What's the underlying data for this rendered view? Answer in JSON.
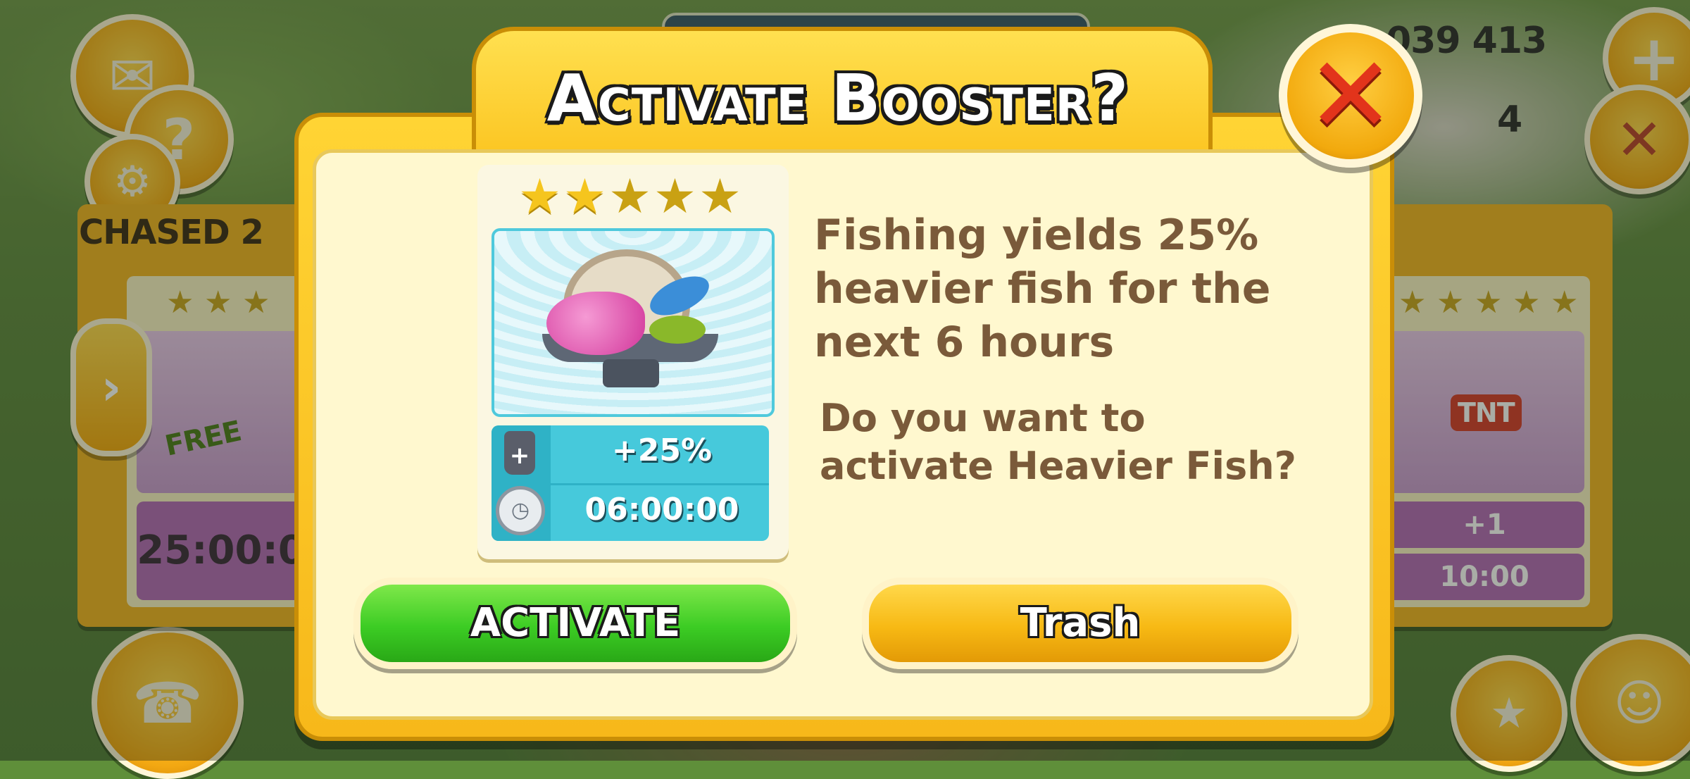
{
  "background": {
    "purchased_label": "CHASED 2",
    "top_number": "039 413",
    "top_count": "4",
    "left_card": {
      "stars": 3,
      "badge": "FREE",
      "timer": "25:00:0"
    },
    "right_card": {
      "stars": 5,
      "item_label": "TNT",
      "bonus": "+1",
      "timer": "10:00"
    }
  },
  "dialog": {
    "title": "Activate Booster?",
    "close_icon": "close-x-icon",
    "booster": {
      "stars_filled": 2,
      "stars_total": 5,
      "image_icon": "fish-bowl-icon",
      "bonus": "+25%",
      "duration": "06:00:00"
    },
    "description": "Fishing yields 25% heavier fish for the next 6 hours",
    "question": "Do you want to activate Heavier Fish?",
    "activate_label": "ACTIVATE",
    "trash_label": "Trash"
  },
  "colors": {
    "dialog_frame": "#f7b81a",
    "dialog_inner": "#fff8cf",
    "text_brown": "#7a5a3a",
    "activate_green": "#3ccc24",
    "trash_orange": "#f7b914",
    "close_red": "#e2341b",
    "stat_teal": "#46c9db"
  }
}
